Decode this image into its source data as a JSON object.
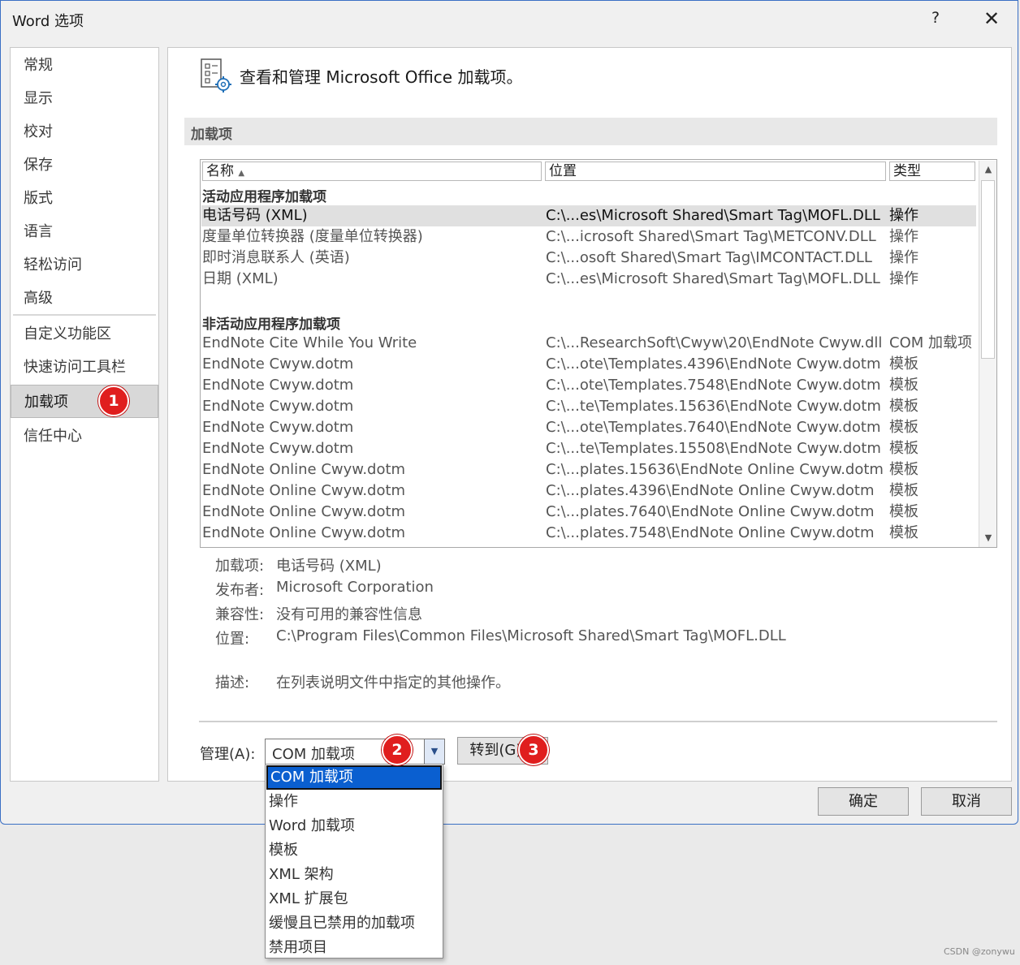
{
  "window": {
    "title": "Word 选项",
    "help_glyph": "?",
    "close_glyph": "✕"
  },
  "nav": {
    "items": [
      "常规",
      "显示",
      "校对",
      "保存",
      "版式",
      "语言",
      "轻松访问",
      "高级"
    ],
    "items2": [
      "自定义功能区",
      "快速访问工具栏"
    ],
    "selected": "加载项",
    "after": "信任中心"
  },
  "header": {
    "text": "查看和管理 Microsoft Office 加载项。"
  },
  "section": {
    "title": "加载项"
  },
  "table": {
    "columns": {
      "name": "名称",
      "location": "位置",
      "type": "类型"
    },
    "active_group": "活动应用程序加载项",
    "active": [
      {
        "name": "电话号码 (XML)",
        "location": "C:\\...es\\Microsoft Shared\\Smart Tag\\MOFL.DLL",
        "type": "操作"
      },
      {
        "name": "度量单位转换器 (度量单位转换器)",
        "location": "C:\\...icrosoft Shared\\Smart Tag\\METCONV.DLL",
        "type": "操作"
      },
      {
        "name": "即时消息联系人 (英语)",
        "location": "C:\\...osoft Shared\\Smart Tag\\IMCONTACT.DLL",
        "type": "操作"
      },
      {
        "name": "日期 (XML)",
        "location": "C:\\...es\\Microsoft Shared\\Smart Tag\\MOFL.DLL",
        "type": "操作"
      }
    ],
    "inactive_group": "非活动应用程序加载项",
    "inactive": [
      {
        "name": "EndNote Cite While You Write",
        "location": "C:\\...ResearchSoft\\Cwyw\\20\\EndNote Cwyw.dll",
        "type": "COM 加载项"
      },
      {
        "name": "EndNote Cwyw.dotm",
        "location": "C:\\...ote\\Templates.4396\\EndNote Cwyw.dotm",
        "type": "模板"
      },
      {
        "name": "EndNote Cwyw.dotm",
        "location": "C:\\...ote\\Templates.7548\\EndNote Cwyw.dotm",
        "type": "模板"
      },
      {
        "name": "EndNote Cwyw.dotm",
        "location": "C:\\...te\\Templates.15636\\EndNote Cwyw.dotm",
        "type": "模板"
      },
      {
        "name": "EndNote Cwyw.dotm",
        "location": "C:\\...ote\\Templates.7640\\EndNote Cwyw.dotm",
        "type": "模板"
      },
      {
        "name": "EndNote Cwyw.dotm",
        "location": "C:\\...te\\Templates.15508\\EndNote Cwyw.dotm",
        "type": "模板"
      },
      {
        "name": "EndNote Online Cwyw.dotm",
        "location": "C:\\...plates.15636\\EndNote Online Cwyw.dotm",
        "type": "模板"
      },
      {
        "name": "EndNote Online Cwyw.dotm",
        "location": "C:\\...plates.4396\\EndNote Online Cwyw.dotm",
        "type": "模板"
      },
      {
        "name": "EndNote Online Cwyw.dotm",
        "location": "C:\\...plates.7640\\EndNote Online Cwyw.dotm",
        "type": "模板"
      },
      {
        "name": "EndNote Online Cwyw.dotm",
        "location": "C:\\...plates.7548\\EndNote Online Cwyw.dotm",
        "type": "模板"
      }
    ]
  },
  "details": {
    "addin_label": "加载项:",
    "addin_value": "电话号码 (XML)",
    "publisher_label": "发布者:",
    "publisher_value": "Microsoft Corporation",
    "compat_label": "兼容性:",
    "compat_value": "没有可用的兼容性信息",
    "location_label": "位置:",
    "location_value": "C:\\Program Files\\Common Files\\Microsoft Shared\\Smart Tag\\MOFL.DLL",
    "desc_label": "描述:",
    "desc_value": "在列表说明文件中指定的其他操作。"
  },
  "manage": {
    "label": "管理(A):",
    "value": "COM 加载项",
    "goto_label": "转到(G)...",
    "options": [
      "COM 加载项",
      "操作",
      "Word 加载项",
      "模板",
      "XML 架构",
      "XML 扩展包",
      "缓慢且已禁用的加载项",
      "禁用项目"
    ]
  },
  "footer": {
    "ok_label": "确定",
    "cancel_label": "取消"
  },
  "badges": [
    "1",
    "2",
    "3"
  ],
  "watermark": "CSDN @zonywu",
  "colors": {
    "accent": "#0a5fd0",
    "badge": "#e01e1e",
    "window_border": "#3a6fc4"
  }
}
